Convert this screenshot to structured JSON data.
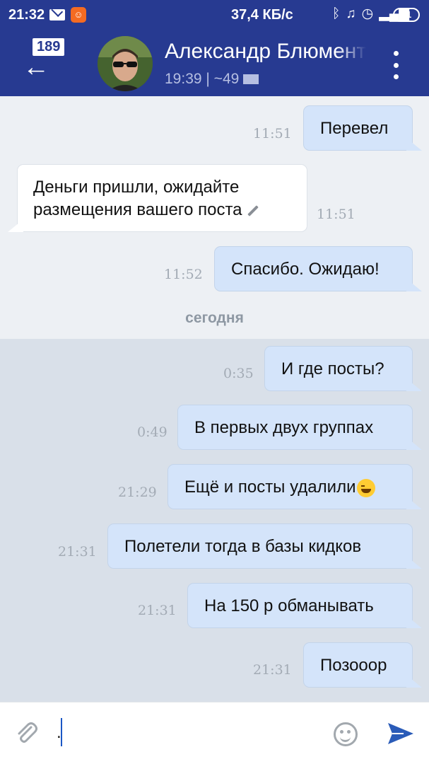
{
  "status_bar": {
    "time": "21:32",
    "network_speed": "37,4 КБ/с",
    "battery": "41",
    "icons": [
      "mail-icon",
      "app-icon",
      "bluetooth-icon",
      "mute-icon",
      "alarm-icon",
      "signal-icon",
      "wifi-icon",
      "battery-icon"
    ]
  },
  "header": {
    "unread_count": "189",
    "contact_name": "Александр Блюменталь",
    "last_seen": "19:39 | ~49",
    "accent_color": "#273a91"
  },
  "chat": {
    "date_separator": "сегодня",
    "messages": [
      {
        "direction": "out",
        "text": "Перевел",
        "time": "11:51"
      },
      {
        "direction": "in",
        "text": "Деньги пришли, ожидайте размещения вашего поста",
        "time": "11:51",
        "edited": true
      },
      {
        "direction": "out",
        "text": "Спасибо. Ожидаю!",
        "time": "11:52"
      },
      {
        "direction": "out",
        "text": "И где посты?",
        "time": "0:35"
      },
      {
        "direction": "out",
        "text": "В первых двух группах",
        "time": "0:49"
      },
      {
        "direction": "out",
        "text": "Ещё и посты удалили",
        "time": "21:29",
        "emoji": "face-with-tears-of-joy"
      },
      {
        "direction": "out",
        "text": "Полетели тогда в базы кидков",
        "time": "21:31"
      },
      {
        "direction": "out",
        "text": "На 150 р обманывать",
        "time": "21:31"
      },
      {
        "direction": "out",
        "text": "Позооор",
        "time": "21:31"
      }
    ]
  },
  "input": {
    "value": "."
  }
}
